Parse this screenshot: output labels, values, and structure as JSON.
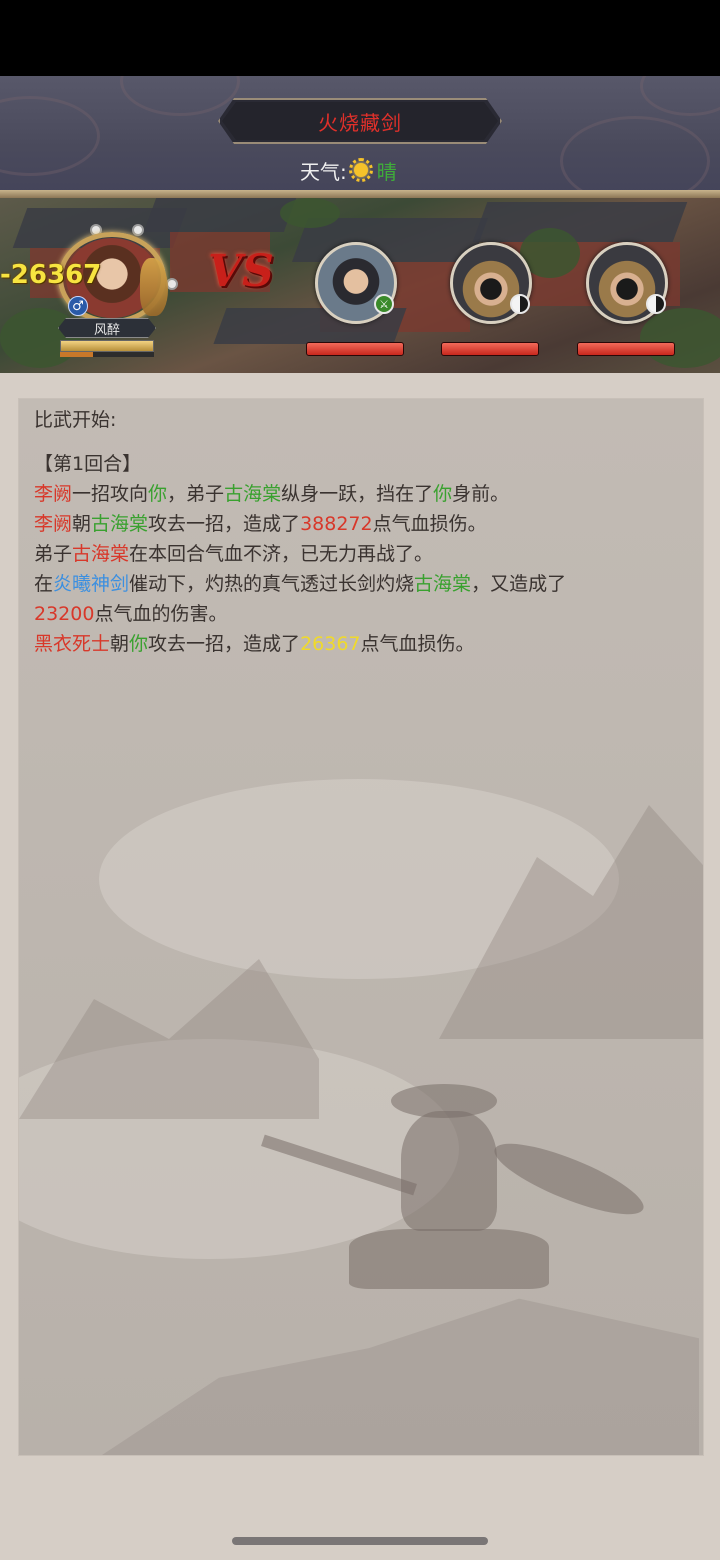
{
  "header": {
    "title": "火烧藏剑",
    "weather_label": "天气:",
    "weather_icon": "sun-icon",
    "weather_value": "晴"
  },
  "battle": {
    "player": {
      "name": "风醉",
      "gender_icon": "male-icon",
      "hp_fraction": 1.0,
      "mp_fraction": 0.35
    },
    "damage_float": "-26367",
    "vs_label": "VS",
    "enemies": [
      {
        "badge_icon": "sword-icon",
        "hp_fraction": 1.0
      },
      {
        "badge_icon": "yinyang-icon",
        "hp_fraction": 1.0
      },
      {
        "badge_icon": "yinyang-icon",
        "hp_fraction": 1.0
      }
    ]
  },
  "log": {
    "start": "比武开始:",
    "round": "【第1回合】",
    "l1": {
      "a": "李阙",
      "b": "一招攻向",
      "c": "你",
      "d": "，弟子",
      "e": "古海棠",
      "f": "纵身一跃，挡在了",
      "g": "你",
      "h": "身前。"
    },
    "l2": {
      "a": "李阙",
      "b": "朝",
      "c": "古海棠",
      "d": "攻去一招，造成了",
      "e": "388272",
      "f": "点气血损伤。"
    },
    "l3": {
      "a": "弟子",
      "b": "古海棠",
      "c": "在本回合气血不济，已无力再战了。"
    },
    "l4": {
      "a": "在",
      "b": "炎曦神剑",
      "c": "催动下，灼热的真气透过长剑灼烧",
      "d": "古海棠",
      "e": "，又造成了",
      "f": "23200",
      "g": "点气血的伤害。"
    },
    "l5": {
      "a": "黑衣死士",
      "b": "朝",
      "c": "你",
      "d": "攻去一招，造成了",
      "e": "26367",
      "f": "点气血损伤。"
    }
  },
  "colors": {
    "title_red": "#e0302a",
    "name_red": "#d8382a",
    "ally_green": "#39a12f",
    "skill_blue": "#3b8fe0",
    "damage_yellow": "#f0da2a"
  }
}
